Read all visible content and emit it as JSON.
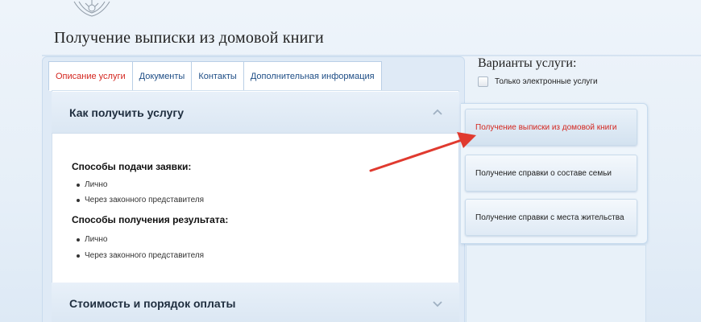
{
  "page": {
    "title": "Получение выписки из домовой книги"
  },
  "tabs": [
    {
      "label": "Описание услуги",
      "active": true
    },
    {
      "label": "Документы",
      "active": false
    },
    {
      "label": "Контакты",
      "active": false
    },
    {
      "label": "Дополнительная информация",
      "active": false
    }
  ],
  "accordion": {
    "section1": {
      "title": "Как получить услугу",
      "state": "expanded"
    },
    "section2": {
      "title": "Стоимость и порядок оплаты",
      "state": "collapsed"
    }
  },
  "content": {
    "apply_title": "Способы подачи заявки:",
    "apply_items": [
      "Лично",
      "Через законного представителя"
    ],
    "result_title": "Способы получения результата:",
    "result_items": [
      "Лично",
      "Через законного представителя"
    ]
  },
  "sidebar": {
    "title": "Варианты услуги:",
    "checkbox_label": "Только электронные услуги",
    "checkbox_checked": false,
    "variants": [
      {
        "label": "Получение выписки из домовой книги",
        "active": true
      },
      {
        "label": "Получение справки о составе семьи",
        "active": false
      },
      {
        "label": "Получение справки с места жительства",
        "active": false
      }
    ]
  },
  "colors": {
    "accent_red": "#d4261f",
    "link_blue": "#1f4e86",
    "arrow_red": "#e03a2f"
  },
  "icons": [
    "emblem-icon",
    "chevron-up-icon",
    "chevron-down-icon",
    "checkbox-icon",
    "annotation-arrow"
  ]
}
